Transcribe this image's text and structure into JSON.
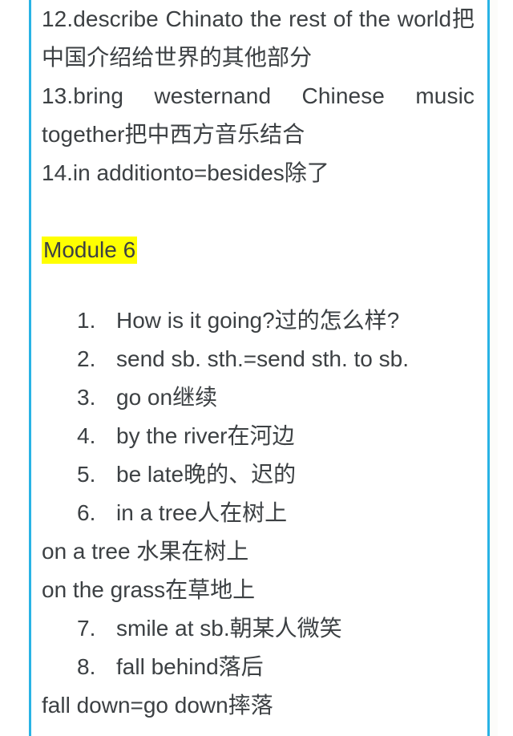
{
  "theme": {
    "rule_color": "#29b3e5",
    "text_color": "#3c4043",
    "highlight_color": "#ffff00",
    "background": "#ffffff"
  },
  "document": {
    "top_paragraphs": [
      "12.describe Chinato the rest of the world把中国介绍给世界的其他部分",
      "13.bring westernand Chinese music together把中西方音乐结合",
      "14.in additionto=besides除了"
    ],
    "section_heading": "Module 6",
    "entries": [
      {
        "kind": "numbered",
        "num": "1.",
        "text": "How is it going?过的怎么样?"
      },
      {
        "kind": "numbered",
        "num": "2.",
        "text": "send sb. sth.=send sth. to sb."
      },
      {
        "kind": "numbered",
        "num": "3.",
        "text": "go on继续"
      },
      {
        "kind": "numbered",
        "num": "4.",
        "text": "by the river在河边"
      },
      {
        "kind": "numbered",
        "num": "5.",
        "text": "be late晚的、迟的"
      },
      {
        "kind": "numbered",
        "num": "6.",
        "text": "in a tree人在树上"
      },
      {
        "kind": "plain",
        "text": "on a tree 水果在树上"
      },
      {
        "kind": "plain",
        "text": "on the grass在草地上"
      },
      {
        "kind": "numbered",
        "num": "7.",
        "text": "smile at sb.朝某人微笑"
      },
      {
        "kind": "numbered",
        "num": "8.",
        "text": "fall behind落后"
      },
      {
        "kind": "plain",
        "text": "fall down=go down摔落"
      }
    ]
  }
}
